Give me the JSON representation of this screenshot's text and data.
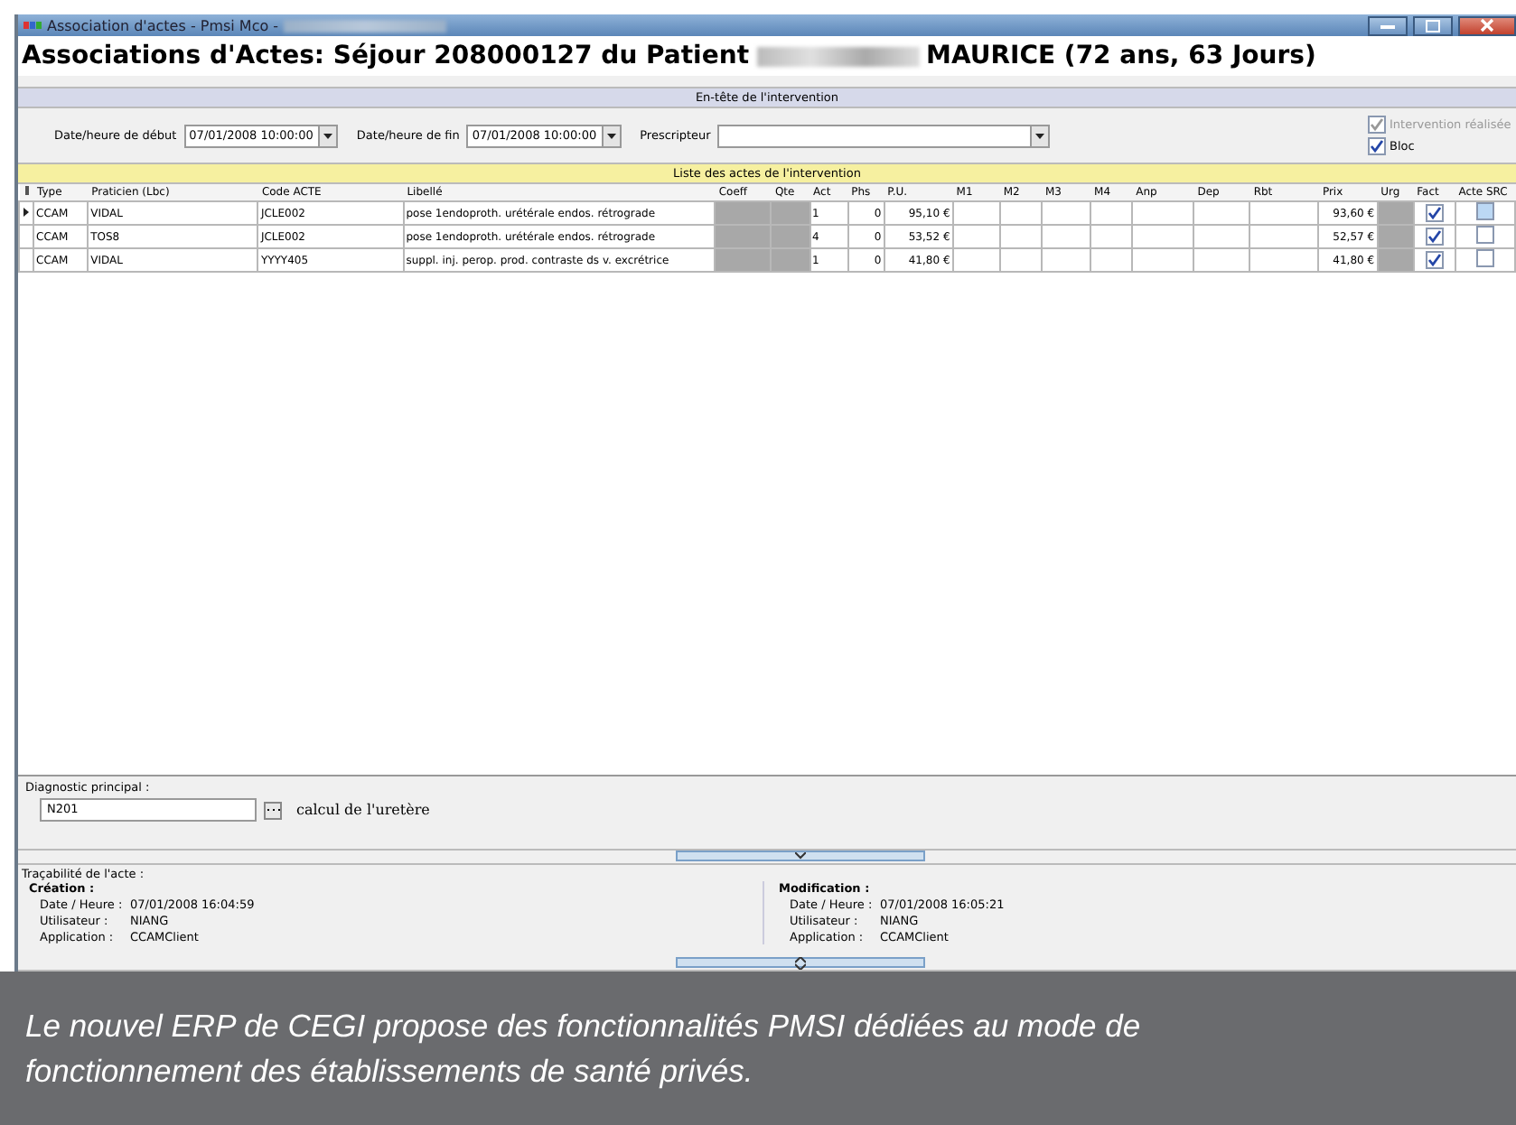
{
  "window": {
    "title": "Association d'actes - Pmsi Mco -"
  },
  "header": {
    "title_start": "Associations d'Actes: Séjour 208000127 du Patient",
    "title_end": "MAURICE (72 ans, 63 Jours)"
  },
  "intervention": {
    "section_title": "En-tête de l'intervention",
    "fields": [
      {
        "label": "Date/heure de début",
        "value": "07/01/2008 10:00:00"
      },
      {
        "label": "Date/heure de fin",
        "value": "07/01/2008 10:00:00"
      }
    ],
    "prescripteur": {
      "label": "Prescripteur"
    },
    "checkboxes": [
      {
        "label": "Intervention réalisée",
        "checked": true,
        "disabled": true
      },
      {
        "label": "Bloc",
        "checked": true,
        "disabled": false
      }
    ]
  },
  "acts": {
    "section_title": "Liste des actes de l'intervention",
    "columns": [
      "Type",
      "Praticien (Lbc)",
      "Code ACTE",
      "Libellé",
      "Coeff",
      "Qte",
      "Act",
      "Phs",
      "P.U.",
      "M1",
      "M2",
      "M3",
      "M4",
      "Anp",
      "Dep",
      "Rbt",
      "Prix",
      "Urg",
      "Fact",
      "Acte SRC"
    ],
    "rows": [
      {
        "selected": true,
        "type": "CCAM",
        "praticien": "VIDAL",
        "code": "JCLE002",
        "libelle": "pose 1endoproth. urétérale endos. rétrograde",
        "act": "1",
        "phs": "0",
        "pu": "95,10 €",
        "prix": "93,60 €",
        "fact": true,
        "acte_src": false
      },
      {
        "selected": false,
        "type": "CCAM",
        "praticien": "TOS8",
        "code": "JCLE002",
        "libelle": "pose 1endoproth. urétérale endos. rétrograde",
        "act": "4",
        "phs": "0",
        "pu": "53,52 €",
        "prix": "52,57 €",
        "fact": true,
        "acte_src": false
      },
      {
        "selected": false,
        "type": "CCAM",
        "praticien": "VIDAL",
        "code": "YYYY405",
        "libelle": "suppl. inj. perop. prod. contraste ds v. excrétrice",
        "act": "1",
        "phs": "0",
        "pu": "41,80 €",
        "prix": "41,80 €",
        "fact": true,
        "acte_src": false
      }
    ]
  },
  "diagnostic": {
    "label": "Diagnostic principal :",
    "value": "N201",
    "description": "calcul de l'uretère"
  },
  "traceability": {
    "title": "Traçabilité de l'acte :",
    "blocks": [
      {
        "title": "Création :",
        "rows": [
          {
            "label": "Date / Heure :",
            "value": "07/01/2008 16:04:59"
          },
          {
            "label": "Utilisateur :",
            "value": "NIANG"
          },
          {
            "label": "Application :",
            "value": "CCAMClient"
          }
        ]
      },
      {
        "title": "Modification :",
        "rows": [
          {
            "label": "Date / Heure :",
            "value": "07/01/2008 16:05:21"
          },
          {
            "label": "Utilisateur :",
            "value": "NIANG"
          },
          {
            "label": "Application :",
            "value": "CCAMClient"
          }
        ]
      }
    ]
  },
  "caption": "Le nouvel ERP de CEGI propose des fonctionnalités PMSI dédiées au mode de fonctionnement des établissements de santé privés."
}
